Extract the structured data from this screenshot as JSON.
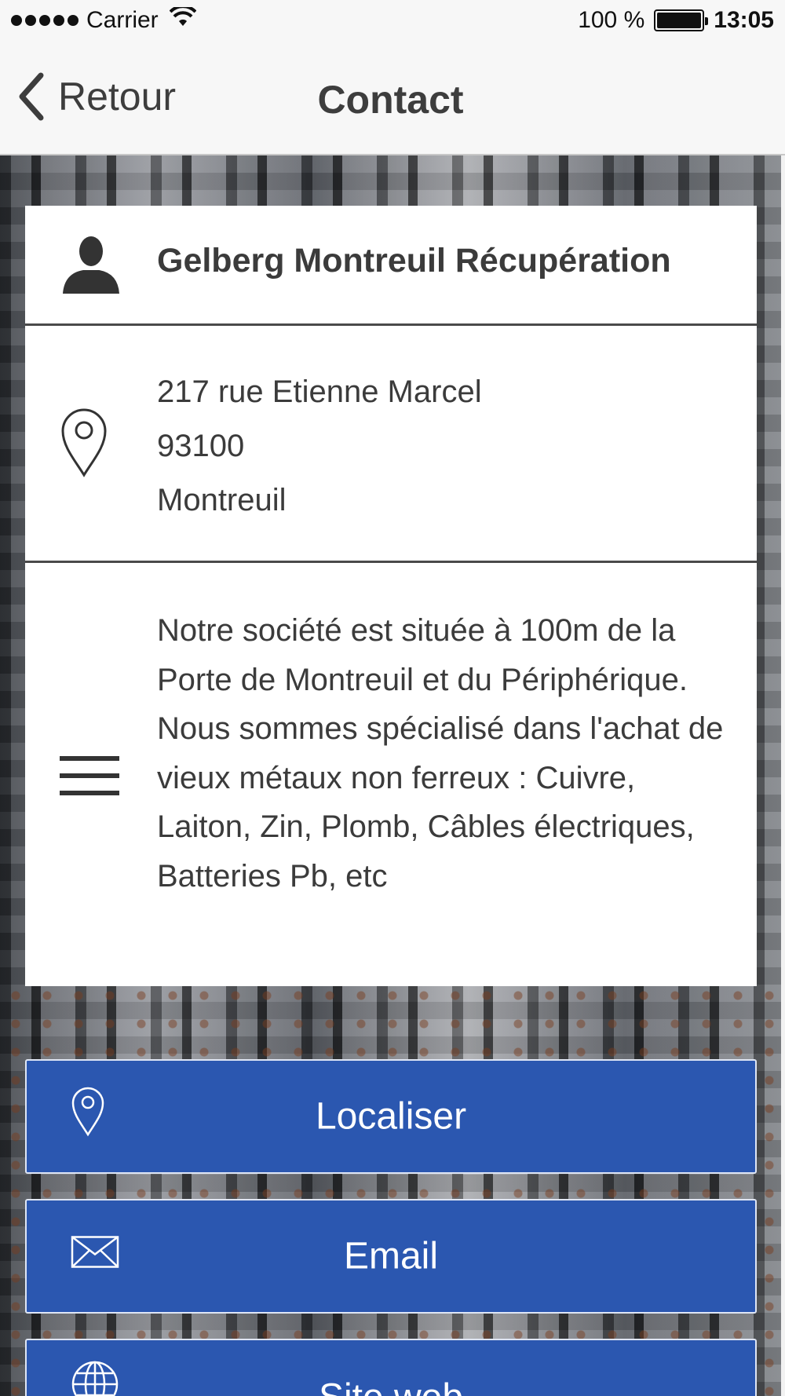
{
  "status_bar": {
    "carrier": "Carrier",
    "battery": "100 %",
    "battery_level": 1.0,
    "time": "13:05"
  },
  "nav": {
    "back_label": "Retour",
    "title": "Contact"
  },
  "card": {
    "name": "Gelberg Montreuil Récupération",
    "address": {
      "street": "217 rue Etienne Marcel",
      "postcode": "93100",
      "city": "Montreuil"
    },
    "description": "Notre société est située à 100m de la Porte de Montreuil et du Périphérique. Nous sommes spécialisé dans l'achat de vieux métaux non ferreux : Cuivre, Laiton, Zin, Plomb, Câbles électriques, Batteries Pb, etc"
  },
  "actions": {
    "locate_label": "Localiser",
    "email_label": "Email",
    "web_label": "Site web"
  },
  "icons": {
    "user": "user-icon",
    "location": "location-pin-icon",
    "description": "menu-lines-icon",
    "email": "envelope-icon",
    "web": "globe-icon",
    "back": "chevron-left-icon"
  },
  "colors": {
    "button_blue": "#2b57b0",
    "nav_bg": "#f7f7f7",
    "text_dark": "#3b3b3b"
  }
}
